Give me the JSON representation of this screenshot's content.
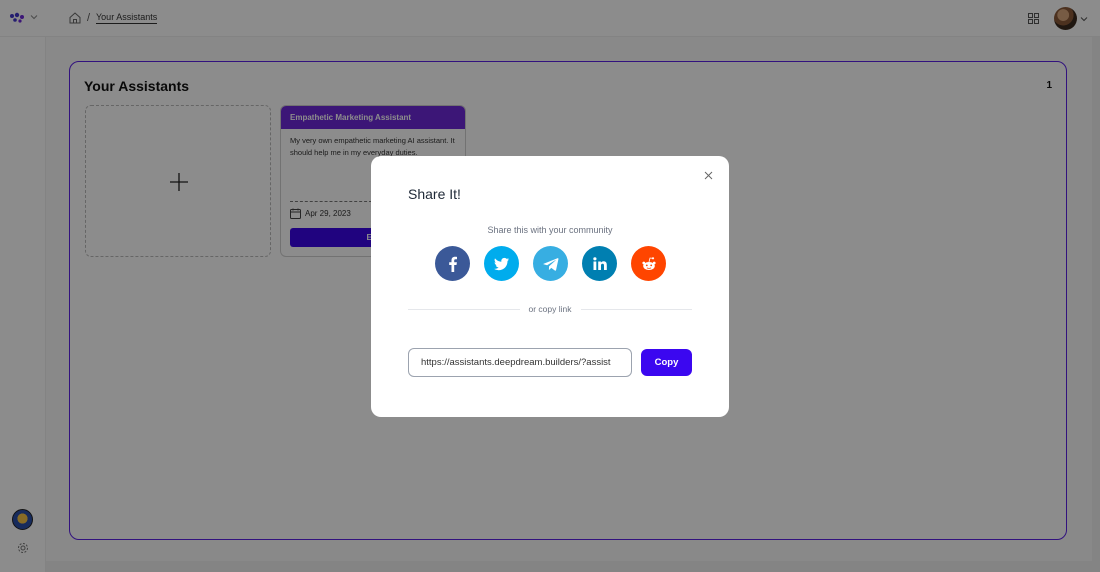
{
  "breadcrumb": {
    "separator": "/",
    "current": "Your Assistants"
  },
  "panel": {
    "title": "Your Assistants",
    "count": "1",
    "assistant_card": {
      "name": "Empathetic Marketing Assistant",
      "description": "My very own empathetic marketing AI assistant. It should help me in my everyday duties.",
      "date": "Apr 29, 2023",
      "edit_label": "Edit"
    }
  },
  "modal": {
    "title": "Share It!",
    "subtitle": "Share this with your community",
    "divider_text": "or copy link",
    "link_value": "https://assistants.deepdream.builders/?assist",
    "copy_label": "Copy",
    "social": [
      {
        "name": "facebook",
        "color": "#3b5998"
      },
      {
        "name": "twitter",
        "color": "#00aced"
      },
      {
        "name": "telegram",
        "color": "#37aee2"
      },
      {
        "name": "linkedin",
        "color": "#007fb1"
      },
      {
        "name": "reddit",
        "color": "#ff4500"
      }
    ]
  },
  "colors": {
    "accent": "#3b07f0",
    "panel_border": "#5b21e6",
    "card_header": "#6d28d9"
  }
}
